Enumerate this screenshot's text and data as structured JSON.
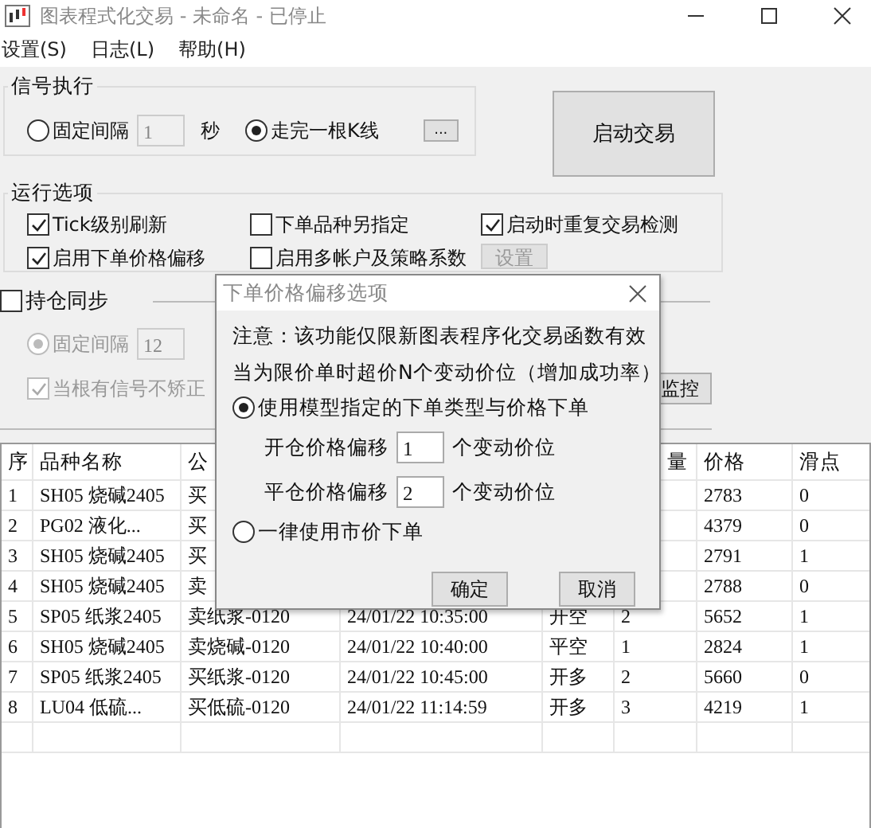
{
  "window": {
    "title": "图表程式化交易 - 未命名 - 已停止"
  },
  "menu": [
    "设置(S)",
    "日志(L)",
    "帮助(H)"
  ],
  "signal_group": {
    "title": "信号执行",
    "options": [
      {
        "label": "固定间隔",
        "selected": false,
        "interval": "1",
        "unit": "秒"
      },
      {
        "label": "走完一根K线",
        "selected": true
      }
    ],
    "more_button": "..."
  },
  "start_button": "启动交易",
  "run_options": {
    "title": "运行选项",
    "checkboxes": [
      {
        "label": "Tick级别刷新",
        "checked": true
      },
      {
        "label": "下单品种另指定",
        "checked": false
      },
      {
        "label": "启动时重复交易检测",
        "checked": true
      },
      {
        "label": "启用下单价格偏移",
        "checked": true
      },
      {
        "label": "启用多帐户及策略系数",
        "checked": false
      }
    ],
    "settings_button": "设置"
  },
  "position_sync": {
    "label": "持仓同步",
    "checked": false,
    "interval_label": "固定间隔",
    "interval_selected": true,
    "interval": "12",
    "no_correct_label": "当根有信号不矫正",
    "no_correct_checked": true,
    "monitor_button": "监控"
  },
  "table": {
    "columns": {
      "no": "序",
      "name": "品种名称",
      "column_3": "公",
      "column_6": "量",
      "price": "价格",
      "slippage": "滑点"
    },
    "rows": [
      {
        "no": "1",
        "name": "SH05 烧碱2405",
        "column_3": "买",
        "price": "2783",
        "slippage": "0"
      },
      {
        "no": "2",
        "name": "PG02 液化...",
        "column_3": "买",
        "price": "4379",
        "slippage": "0"
      },
      {
        "no": "3",
        "name": "SH05 烧碱2405",
        "column_3": "买",
        "price": "2791",
        "slippage": "1"
      },
      {
        "no": "4",
        "name": "SH05 烧碱2405",
        "column_3": "卖",
        "price": "2788",
        "slippage": "0"
      },
      {
        "no": "5",
        "name": "SP05 纸浆2405",
        "column_3": "卖纸浆-0120",
        "time": "24/01/22 10:35:00",
        "side": "开空",
        "column_6": "2",
        "price": "5652",
        "slippage": "1"
      },
      {
        "no": "6",
        "name": "SH05 烧碱2405",
        "column_3": "卖烧碱-0120",
        "time": "24/01/22 10:40:00",
        "side": "平空",
        "column_6": "1",
        "price": "2824",
        "slippage": "1"
      },
      {
        "no": "7",
        "name": "SP05 纸浆2405",
        "column_3": "买纸浆-0120",
        "time": "24/01/22 10:45:00",
        "side": "开多",
        "column_6": "2",
        "price": "5660",
        "slippage": "0"
      },
      {
        "no": "8",
        "name": "LU04 低硫...",
        "column_3": "买低硫-0120",
        "time": "24/01/22 11:14:59",
        "side": "开多",
        "column_6": "3",
        "price": "4219",
        "slippage": "1"
      }
    ]
  },
  "dialog": {
    "title": "下单价格偏移选项",
    "notes": [
      "注意：该功能仅限新图表程序化交易函数有效",
      "当为限价单时超价N个变动价位（增加成功率）"
    ],
    "options": [
      {
        "label": "使用模型指定的下单类型与价格下单",
        "selected": true
      },
      {
        "label": "一律使用市价下单",
        "selected": false
      }
    ],
    "offsets": [
      {
        "label": "开仓价格偏移",
        "value": "1",
        "unit": "个变动价位"
      },
      {
        "label": "平仓价格偏移",
        "value": "2",
        "unit": "个变动价位"
      }
    ],
    "buttons": [
      "确定",
      "取消"
    ]
  }
}
